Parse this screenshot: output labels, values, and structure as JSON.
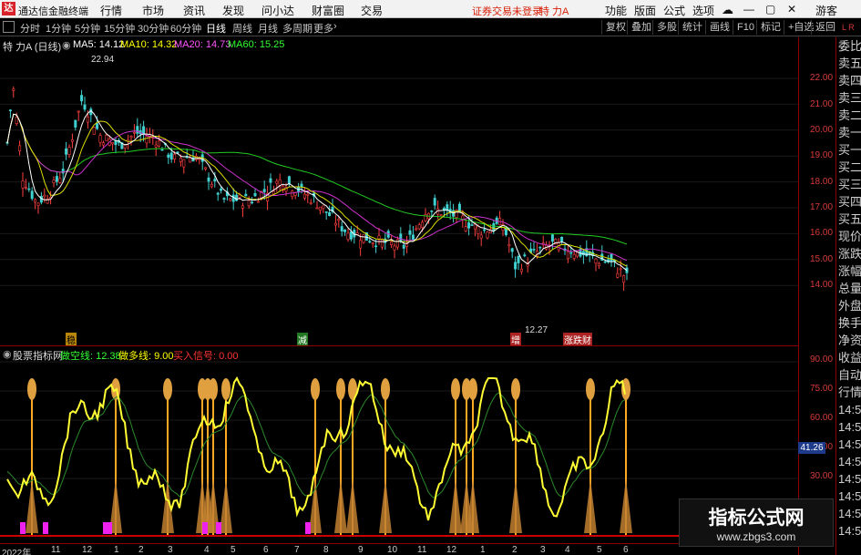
{
  "titlebar": {
    "app_name": "通达信金融终端",
    "menus": [
      "行情",
      "市场",
      "资讯",
      "发现",
      "问小达",
      "财富圈",
      "交易"
    ],
    "login_status": "证券交易未登录",
    "stock": "特 力A",
    "right_menus": [
      "功能",
      "版面",
      "公式",
      "选项"
    ],
    "guest": "游客"
  },
  "toolbar": {
    "periods": [
      "分时",
      "1分钟",
      "5分钟",
      "15分钟",
      "30分钟",
      "60分钟",
      "日线",
      "周线",
      "月线",
      "多周期",
      "更多"
    ],
    "active_period": "日线",
    "right_buttons": [
      "复权",
      "叠加",
      "多股",
      "统计",
      "画线",
      "F10",
      "标记",
      "+自选",
      "返回"
    ]
  },
  "price_header": {
    "stock_label": "特 力A (日线)",
    "ma5": "MA5: 14.12",
    "ma10": "MA10: 14.32",
    "ma20": "MA20: 14.73",
    "ma60": "MA60: 15.25",
    "colors": {
      "ma5": "#ffffff",
      "ma10": "#ffff00",
      "ma20": "#ff00ff",
      "ma60": "#00ff00"
    }
  },
  "price_chart": {
    "ylabels": [
      "22.00",
      "21.00",
      "20.00",
      "19.00",
      "18.00",
      "17.00",
      "16.00",
      "15.00",
      "14.00"
    ],
    "high_label": "22.94",
    "low_label": "12.27",
    "markers": [
      "稳",
      "减",
      "增",
      "涨跌财"
    ]
  },
  "indicator_header": {
    "name": "股票指标网",
    "line1": "做空线: 12.38",
    "line2": "做多线: 9.00",
    "line3": "买入信号: 0.00"
  },
  "indicator_chart": {
    "ylabels": [
      "90.00",
      "75.00",
      "60.00",
      "45.00",
      "30.00"
    ],
    "current_value": "41.26"
  },
  "xaxis": {
    "labels": [
      "2022年",
      "11",
      "12",
      "1",
      "2",
      "3",
      "4",
      "5",
      "6",
      "7",
      "8",
      "9",
      "10",
      "11",
      "12",
      "1",
      "2",
      "3",
      "4",
      "5",
      "6"
    ]
  },
  "right_panel": {
    "items": [
      "委比",
      "卖五",
      "卖四",
      "卖三",
      "卖二",
      "卖一",
      "买一",
      "买二",
      "买三",
      "买四",
      "买五",
      "现价",
      "涨跌",
      "涨幅",
      "总量",
      "外盘",
      "换手",
      "净资",
      "收益",
      "自动",
      "行情",
      "14:5",
      "14:5",
      "14:5",
      "14:5",
      "14:5",
      "14:5",
      "14:5",
      "14:5"
    ]
  },
  "watermark": {
    "line1": "指标公式网",
    "line2": "www.zbgs3.com"
  }
}
